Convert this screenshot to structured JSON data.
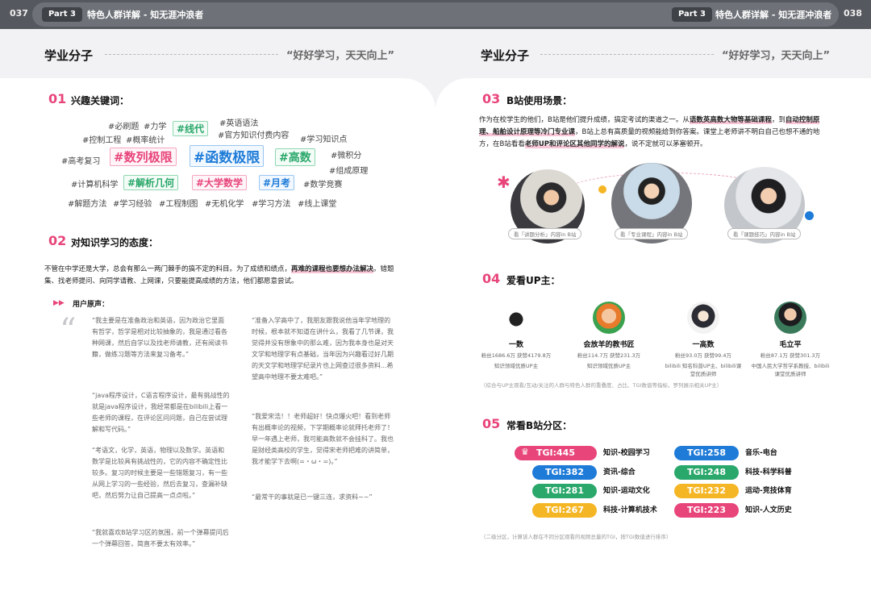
{
  "header": {
    "left_page_num": "037",
    "right_page_num": "038",
    "part_label": "Part 3",
    "section_title": "特色人群详解 - 知无涯冲浪者"
  },
  "colors": {
    "pink": "#e8457a",
    "green": "#2aa76a",
    "blue": "#1e7bd8",
    "yellow": "#f5b625"
  },
  "left": {
    "page_title": "学业分子",
    "page_quote": "“好好学习，天天向上”",
    "s01": {
      "num": "01",
      "title": "兴趣关键词：",
      "keywords": [
        {
          "text": "#必刷题",
          "style": "plain"
        },
        {
          "text": "#力学",
          "style": "plain"
        },
        {
          "text": "#线代",
          "style": "green"
        },
        {
          "text": "#英语语法",
          "style": "plain"
        },
        {
          "text": "#控制工程",
          "style": "plain"
        },
        {
          "text": "#概率统计",
          "style": "plain"
        },
        {
          "text": "#官方知识付费内容",
          "style": "plain"
        },
        {
          "text": "#学习知识点",
          "style": "plain"
        },
        {
          "text": "#高考复习",
          "style": "plain"
        },
        {
          "text": "#数列极限",
          "style": "pink"
        },
        {
          "text": "#函数极限",
          "style": "blue"
        },
        {
          "text": "#高数",
          "style": "green"
        },
        {
          "text": "#微积分",
          "style": "plain"
        },
        {
          "text": "#组成原理",
          "style": "plain"
        },
        {
          "text": "#计算机科学",
          "style": "plain"
        },
        {
          "text": "#解析几何",
          "style": "green"
        },
        {
          "text": "#大学数学",
          "style": "pink"
        },
        {
          "text": "#月考",
          "style": "blue"
        },
        {
          "text": "#数学竞赛",
          "style": "plain"
        },
        {
          "text": "#解题方法",
          "style": "plain"
        },
        {
          "text": "#学习经验",
          "style": "plain"
        },
        {
          "text": "#工程制图",
          "style": "plain"
        },
        {
          "text": "#无机化学",
          "style": "plain"
        },
        {
          "text": "#学习方法",
          "style": "plain"
        },
        {
          "text": "#线上课堂",
          "style": "plain"
        }
      ]
    },
    "s02": {
      "num": "02",
      "title": "对知识学习的态度：",
      "para_a": "不管在中学还是大学，总会有那么一两门棘手的搞不定的科目。为了成绩和绩点，",
      "para_hl": "再难的课程也要想办法解决",
      "para_b": "。错题集、找老师提问、向同学请教、上网课，只要能提高成绩的方法，他们都愿意尝试。",
      "voice_label": "用户原声：",
      "quote_mark": "“",
      "quotes_col1": [
        "“我主要是在准备政治和英语，因为政治它里面有哲学，哲学是相对比较抽象的，我是通过看各种网课，然后自学以及找老师请教，还有阅读书籍，做练习题等方法来复习备考。”",
        "“java程序设计，C语言程序设计，最有挑战性的就是java程序设计，我经常都是在bilibili上看一些老师的课程，在评论区问问题，自己在尝试理解和写代码。”",
        "“考语文，化学，英语，物理以及数学。英语和数学是比较具有挑战性的，它的内容不确定性比较多。复习的时候主要是一些错题复习，有一些从网上学习的一些经验，然后去复习，查漏补缺吧，然后努力让自己提高一点点啦。”",
        "“我就喜欢B站学习区的氛围，前一个弹幕提问后一个弹幕回答，简直不要太有效率。”"
      ],
      "quotes_col2": [
        "“准备入学高中了，我朋友跟我说他当年学地理的时候，根本就不知道在讲什么，我看了几节课，我觉得并没有想象中的那么难，因为我本身也是对天文学和地理学有点基础，当年因为兴趣看过好几期的天文学和地理学纪录片也上网查过很多资料...希望高中地理不要太难吧。”",
        "“我爱宋浩！！老师超好！快点爆火吧！看到老师有出概率论的视频，下学期概率论就拜托老师了！早一年遇上老师，我可能高数就不会挂科了。我也是财经类高校的学生，觉得宋老师把难的讲简单，我才能学下去啊(=・ω・=)。”",
        "“最常干的事就是已一键三连，求资料~~”"
      ]
    }
  },
  "right": {
    "page_title": "学业分子",
    "page_quote": "“好好学习，天天向上”",
    "s03": {
      "num": "03",
      "title": "B站使用场景：",
      "para_a": "作为在校学生的他们，B站是他们提升成绩，搞定考试的渠道之一。从",
      "para_hl1": "语数英高数大物等基础课程",
      "para_b": "，到",
      "para_hl2": "自动控制原理、船舶设计原理等冷门专业课",
      "para_c": "，B站上总有高质量的视频能给到你答案。课堂上老师讲不明白自己也想不通的地方，在B站看看",
      "para_hl3": "老师UP和评论区其他同学的解说",
      "para_d": "，说不定就可以茅塞顿开。",
      "captions": [
        "看「讲题分析」内容in B站",
        "看「专业课程」内容in B站",
        "看「课题技巧」内容in B站"
      ]
    },
    "s04": {
      "num": "04",
      "title": "爱看UP主：",
      "ups": [
        {
          "name": "一数",
          "stats": "粉丝1686.6万  获赞4179.8万",
          "desc": "知识领域优质UP主"
        },
        {
          "name": "会放羊的教书匠",
          "stats": "粉丝114.7万  获赞231.3万",
          "desc": "知识领域优质UP主"
        },
        {
          "name": "一高数",
          "stats": "粉丝93.0万  获赞99.4万",
          "desc": "bilibili 知名科普UP主、bilibili课堂优质讲师"
        },
        {
          "name": "毛立平",
          "stats": "粉丝87.1万  获赞301.3万",
          "desc": "中国人民大学哲学系教授、bilibili课堂优质讲师"
        }
      ],
      "note": "（综合与UP主观看/互动/关注的人群与特色人群的重叠度、占比、TGI数值等指标，罗列展示相关UP主）"
    },
    "s05": {
      "num": "05",
      "title": "常看B站分区：",
      "zones": [
        {
          "tgi": "TGI:445",
          "name": "知识-校园学习",
          "color": "#e8457a",
          "crown": true
        },
        {
          "tgi": "TGI:382",
          "name": "资讯-综合",
          "color": "#1e7bd8",
          "crown": false
        },
        {
          "tgi": "TGI:281",
          "name": "知识-运动文化",
          "color": "#2aa76a",
          "crown": false
        },
        {
          "tgi": "TGI:267",
          "name": "科技-计算机技术",
          "color": "#f5b625",
          "crown": false
        },
        {
          "tgi": "TGI:258",
          "name": "音乐-电台",
          "color": "#1e7bd8",
          "crown": false
        },
        {
          "tgi": "TGI:248",
          "name": "科技-科学科普",
          "color": "#2aa76a",
          "crown": false
        },
        {
          "tgi": "TGI:232",
          "name": "运动-竞技体育",
          "color": "#f5b625",
          "crown": false
        },
        {
          "tgi": "TGI:223",
          "name": "知识-人文历史",
          "color": "#e8457a",
          "crown": false
        }
      ],
      "note": "（二级分区，计算该人群在不同分区观看的视频总量的TGI，按TGI数值进行排序）"
    }
  }
}
